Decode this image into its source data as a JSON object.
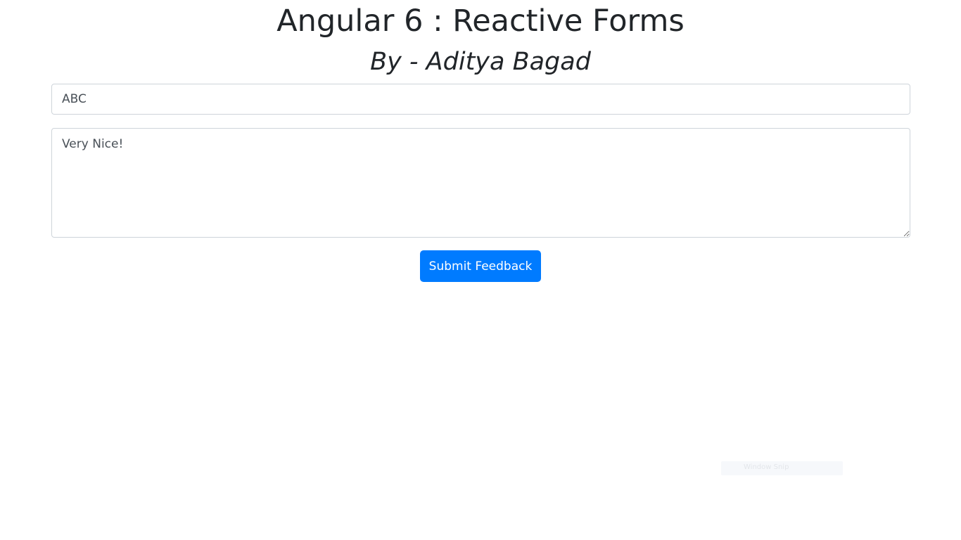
{
  "header": {
    "title": "Angular 6 : Reactive Forms",
    "subtitle": "By - Aditya Bagad"
  },
  "form": {
    "name_value": "ABC",
    "feedback_value": "Very Nice!",
    "submit_label": "Submit Feedback"
  },
  "overlay": {
    "snap_hint_label": "Window Snip"
  },
  "colors": {
    "primary": "#007bff",
    "text": "#212529",
    "input_text": "#495057",
    "input_border": "#ced4da"
  }
}
